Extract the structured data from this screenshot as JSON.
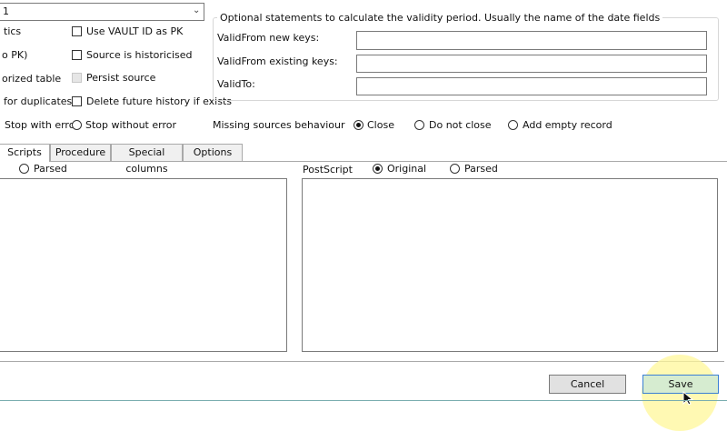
{
  "top_combo": {
    "value": "1"
  },
  "left_options": {
    "row1": "tics",
    "row2": "o PK)",
    "row3": "orized table",
    "row4": "for duplicates"
  },
  "checkboxes": {
    "vault_id_pk": "Use VAULT ID as PK",
    "source_historicised": "Source is historicised",
    "persist_source": "Persist source",
    "delete_future_history": "Delete future history if exists"
  },
  "error_radios": {
    "stop_with_error": "Stop with error",
    "stop_without_error": "Stop without error"
  },
  "validity_group": {
    "legend": "Optional statements to calculate the validity period. Usually the name of the date fields",
    "valid_from_new_label": "ValidFrom new keys:",
    "valid_from_new_value": "",
    "valid_from_existing_label": "ValidFrom existing keys:",
    "valid_from_existing_value": "",
    "valid_to_label": "ValidTo:",
    "valid_to_value": ""
  },
  "missing_sources": {
    "label": "Missing sources behaviour",
    "options": [
      "Close",
      "Do not close",
      "Add empty record"
    ],
    "selected": "Close"
  },
  "tabs": [
    "Scripts",
    "Procedure",
    "Special columns",
    "Options"
  ],
  "active_tab": "Scripts",
  "prescript": {
    "parsed_label": "Parsed"
  },
  "postscript": {
    "label": "PostScript",
    "original_label": "Original",
    "parsed_label": "Parsed",
    "selected": "Original"
  },
  "buttons": {
    "cancel": "Cancel",
    "save": "Save"
  },
  "colors": {
    "save_bg": "#d6ecd0",
    "highlight": "#fff79a",
    "accent_line": "#7aaeb0"
  }
}
